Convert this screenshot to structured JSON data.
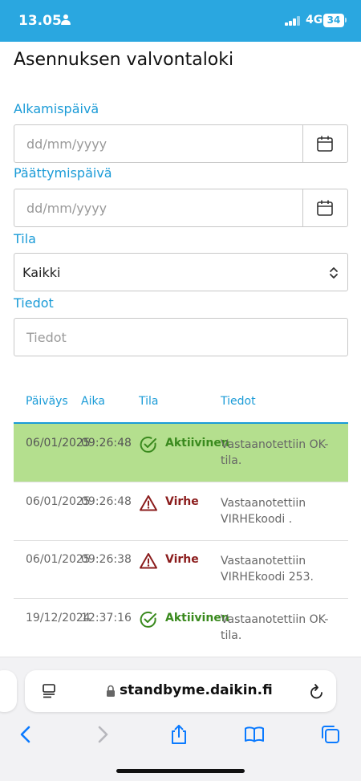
{
  "status_bar": {
    "time": "13.05",
    "network": "4G",
    "battery": "34"
  },
  "page": {
    "title": "Asennuksen valvontaloki"
  },
  "filters": {
    "start_label": "Alkamispäivä",
    "start_placeholder": "dd/mm/yyyy",
    "end_label": "Päättymispäivä",
    "end_placeholder": "dd/mm/yyyy",
    "state_label": "Tila",
    "state_value": "Kaikki",
    "info_label": "Tiedot",
    "info_placeholder": "Tiedot"
  },
  "table": {
    "headers": [
      "Päiväys",
      "Aika",
      "Tila",
      "Tiedot"
    ],
    "rows": [
      {
        "date": "06/01/2025",
        "time": "09:26:48",
        "status": "Aktiivinen",
        "info_line1": "Vastaanotettiin OK-",
        "info_line2": "tila."
      },
      {
        "date": "06/01/2025",
        "time": "09:26:48",
        "status": "Virhe",
        "info_line1": "Vastaanotettiin",
        "info_line2": "VIRHEkoodi ."
      },
      {
        "date": "06/01/2025",
        "time": "09:26:38",
        "status": "Virhe",
        "info_line1": "Vastaanotettiin",
        "info_line2": "VIRHEkoodi 253."
      },
      {
        "date": "19/12/2024",
        "time": "12:37:16",
        "status": "Aktiivinen",
        "info_line1": "Vastaanotettiin OK-",
        "info_line2": "tila."
      }
    ]
  },
  "browser": {
    "url": "standbyme.daikin.fi"
  },
  "icons": {
    "calendar": "calendar-icon",
    "select": "chevron-updown-icon",
    "ok": "check-circle-icon",
    "error": "warning-triangle-icon",
    "reader": "reader-mode-icon",
    "lock": "lock-icon",
    "reload": "reload-icon",
    "back": "back-icon",
    "forward": "forward-icon",
    "share": "share-icon",
    "bookmarks": "bookmarks-icon",
    "tabs": "tabs-icon"
  },
  "colors": {
    "brand": "#2aa7e0",
    "label": "#1a9bd7",
    "active_row": "#b4df8e",
    "ok": "#3a8a1e",
    "error": "#8b1c1c",
    "ios_blue": "#0a7aff"
  }
}
